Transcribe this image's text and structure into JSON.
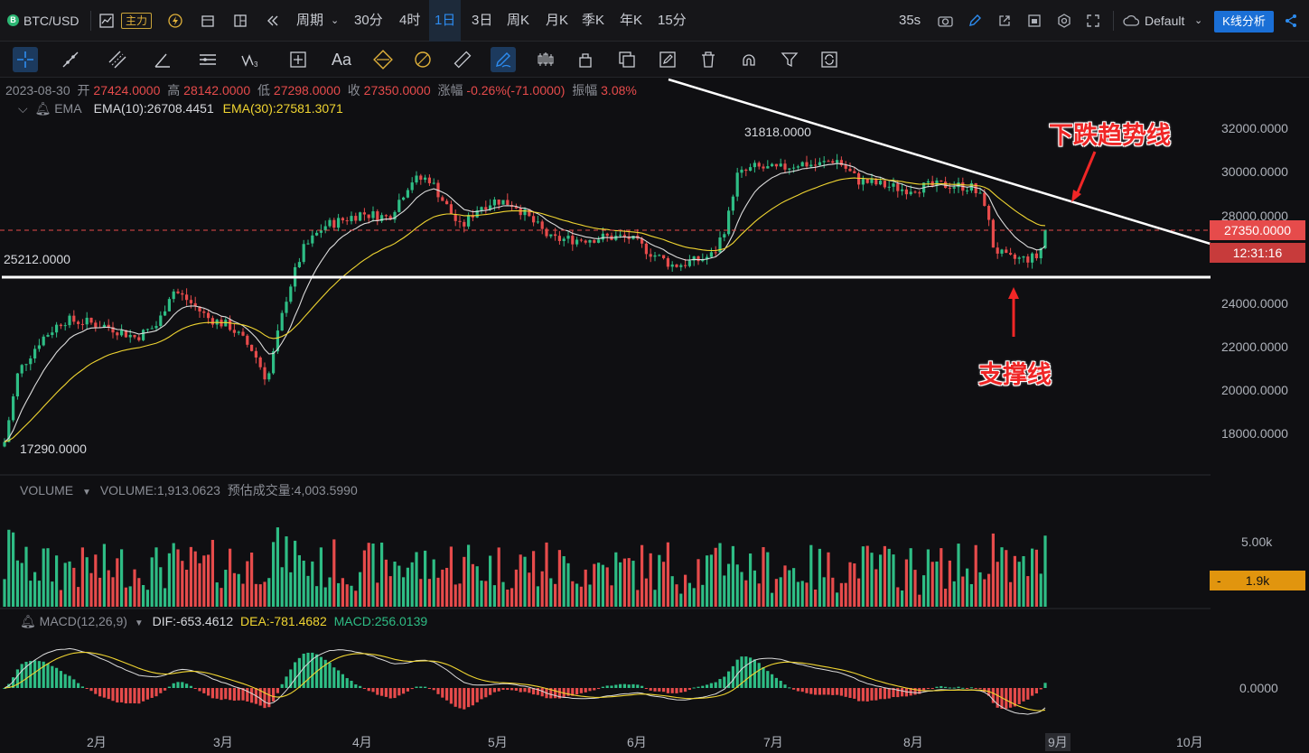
{
  "topbar": {
    "symbol": "BTC/USD",
    "badge": "主力",
    "period_label": "周期",
    "periods": [
      "30分",
      "4时",
      "1日",
      "3日",
      "周K",
      "月K",
      "季K",
      "年K",
      "15分"
    ],
    "active_period": "1日",
    "countdown": "35s",
    "theme": "Default",
    "analysis_button": "K线分析"
  },
  "toolbar": {
    "text_tool": "Aa"
  },
  "ohlc": {
    "date": "2023-08-30",
    "open_label": "开",
    "open": "27424.0000",
    "high_label": "高",
    "high": "28142.0000",
    "low_label": "低",
    "low": "27298.0000",
    "close_label": "收",
    "close": "27350.0000",
    "change_label": "涨幅",
    "change": "-0.26%(-71.0000)",
    "amp_label": "振幅",
    "amp": "3.08%"
  },
  "ema": {
    "name": "EMA",
    "ema10": "EMA(10):26708.4451",
    "ema30": "EMA(30):27581.3071"
  },
  "volume": {
    "name": "VOLUME",
    "value": "VOLUME:1,913.0623",
    "estimate": "预估成交量:4,003.5990",
    "axis_label": "5.00k",
    "current_tag": "1.9k",
    "tag_dash": "-"
  },
  "macd": {
    "name": "MACD(12,26,9)",
    "dif": "DIF:-653.4612",
    "dea": "DEA:-781.4682",
    "macd": "MACD:256.0139",
    "zero_label": "0.0000"
  },
  "price_axis": [
    "32000.0000",
    "30000.0000",
    "28000.0000",
    "24000.0000",
    "22000.0000",
    "20000.0000",
    "18000.0000"
  ],
  "current_price_tag": "27350.0000",
  "countdown_tag": "12:31:16",
  "time_axis": [
    "2月",
    "3月",
    "4月",
    "5月",
    "6月",
    "7月",
    "8月",
    "9月",
    "10月"
  ],
  "marks": {
    "low": "17290.0000",
    "high": "31818.0000",
    "support_level": "25212.0000"
  },
  "annotations": {
    "downtrend": "下跌趋势线",
    "support": "支撑线"
  },
  "colors": {
    "up": "#2ebd85",
    "down": "#e64b4b",
    "ema10": "#dcdcdc",
    "ema30": "#f0d531",
    "accent": "#2d8cf0"
  },
  "chart_data": {
    "type": "candlestick",
    "symbol": "BTC/USD",
    "interval": "1D",
    "ylim": [
      16500,
      33500
    ],
    "key_points": [
      {
        "date": "2023-01-13",
        "low": 17290
      },
      {
        "date": "2023-07-14",
        "high": 31818
      },
      {
        "date": "2023-08-30",
        "open": 27424,
        "high": 28142,
        "low": 27298,
        "close": 27350
      }
    ],
    "support_line": 25212,
    "monthly_closes_approx": [
      {
        "month": "2月",
        "value": 23100
      },
      {
        "month": "3月",
        "value": 22300
      },
      {
        "month": "4月",
        "value": 28500
      },
      {
        "month": "5月",
        "value": 28000
      },
      {
        "month": "6月",
        "value": 27000
      },
      {
        "month": "7月",
        "value": 30500
      },
      {
        "month": "8月",
        "value": 29200
      },
      {
        "month": "9月",
        "value": 27350
      }
    ]
  }
}
